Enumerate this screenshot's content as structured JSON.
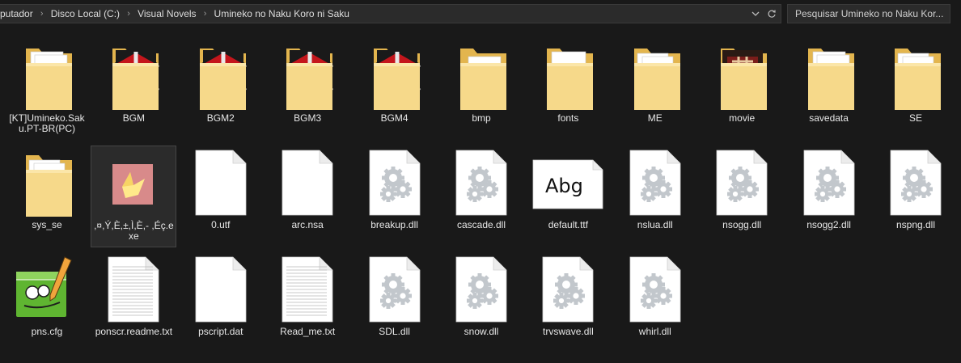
{
  "breadcrumb": {
    "items": [
      "putador",
      "Disco Local (C:)",
      "Visual Novels",
      "Umineko no Naku Koro ni Saku"
    ]
  },
  "search": {
    "placeholder": "Pesquisar Umineko no Naku Kor..."
  },
  "colors": {
    "background": "#191919",
    "bar": "#2b2b2b",
    "text": "#e6e6e6",
    "folder": "#f3d27a",
    "umineko_red": "#c4161c"
  },
  "files": [
    {
      "name": "[KT]Umineko.Saku.PT-BR(PC)",
      "kind": "folder-doc"
    },
    {
      "name": "BGM",
      "kind": "folder-umineko"
    },
    {
      "name": "BGM2",
      "kind": "folder-umineko"
    },
    {
      "name": "BGM3",
      "kind": "folder-umineko"
    },
    {
      "name": "BGM4",
      "kind": "folder-umineko"
    },
    {
      "name": "bmp",
      "kind": "folder-bmp"
    },
    {
      "name": "fonts",
      "kind": "folder-fonts"
    },
    {
      "name": "ME",
      "kind": "folder-audio"
    },
    {
      "name": "movie",
      "kind": "folder-movie"
    },
    {
      "name": "savedata",
      "kind": "folder-doc"
    },
    {
      "name": "SE",
      "kind": "folder-audio"
    },
    {
      "name": "sys_se",
      "kind": "folder-audio"
    },
    {
      "name": ",¤,Ý,È,±,Ì,È,- ,Éç.exe",
      "kind": "exe"
    },
    {
      "name": "0.utf",
      "kind": "blank"
    },
    {
      "name": "arc.nsa",
      "kind": "blank"
    },
    {
      "name": "breakup.dll",
      "kind": "dll"
    },
    {
      "name": "cascade.dll",
      "kind": "dll"
    },
    {
      "name": "default.ttf",
      "kind": "font"
    },
    {
      "name": "nslua.dll",
      "kind": "dll"
    },
    {
      "name": "nsogg.dll",
      "kind": "dll"
    },
    {
      "name": "nsogg2.dll",
      "kind": "dll"
    },
    {
      "name": "nspng.dll",
      "kind": "dll"
    },
    {
      "name": "pns.cfg",
      "kind": "notepad"
    },
    {
      "name": "ponscr.readme.txt",
      "kind": "text"
    },
    {
      "name": "pscript.dat",
      "kind": "blank"
    },
    {
      "name": "Read_me.txt",
      "kind": "text"
    },
    {
      "name": "SDL.dll",
      "kind": "dll"
    },
    {
      "name": "snow.dll",
      "kind": "dll"
    },
    {
      "name": "trvswave.dll",
      "kind": "dll"
    },
    {
      "name": "whirl.dll",
      "kind": "dll"
    }
  ],
  "font_preview_text": "Abg",
  "selected_index": 12
}
